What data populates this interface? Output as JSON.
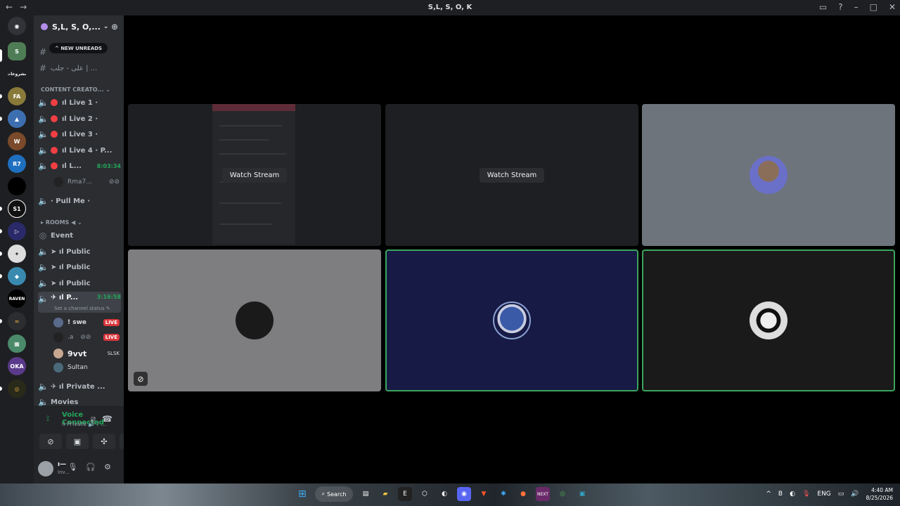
{
  "window": {
    "title": "S,L, S, O, K"
  },
  "guild": {
    "name": "S,L, S, O,...",
    "new_unreads": "NEW UNREADS"
  },
  "channels": {
    "text_channel": "على - جلب | ...",
    "category_content": "CONTENT CREATO...",
    "live1": "ıl Live 1 ·",
    "live2": "ıl Live 2 ·",
    "live3": "ıl Live 3 ·",
    "live4": "ıl Live 4 · P...",
    "live5": "ıl L...",
    "live5_timer": "8:03:34",
    "live5_user": "Rma7...",
    "pullme": "· Pull Me ·",
    "category_rooms": "ROOMS ◀",
    "event": "Event",
    "public1": "➤ ıl Public",
    "public2": "➤ ıl Public",
    "public3": "➤ ıl Public",
    "private_active": "✈ ıl P...",
    "private_timer": "3:16:58",
    "status_hint": "Set a channel status ✎",
    "member1": "! swe",
    "member2": ".a",
    "member3": "9vvt",
    "member4": "Sultan",
    "member_tag": "SLSK",
    "live_badge": "LIVE",
    "private2": "✈ ıl Private ...",
    "movies": "Movies"
  },
  "voice": {
    "connected": "Voice Connected",
    "channel": "ıl Private 🔊 / ..."
  },
  "user": {
    "name": "ı—",
    "status": "Inv..."
  },
  "stage": {
    "watch_label": "Watch Stream"
  },
  "taskbar": {
    "search": "Search",
    "lang": "ENG",
    "time": "4:40 AM",
    "date": "8/25/2026"
  }
}
